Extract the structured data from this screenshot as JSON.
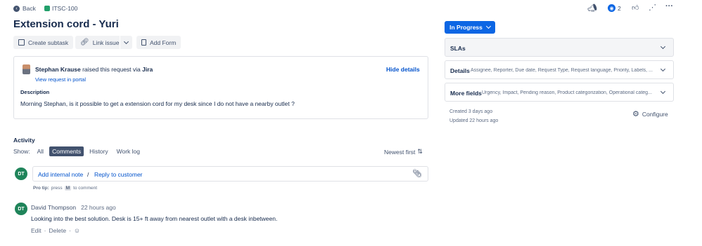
{
  "nav": {
    "back_label": "Back",
    "issue_key": "ITSC-100"
  },
  "header": {
    "title": "Extension cord - Yuri",
    "watch_count": "2"
  },
  "toolbar": {
    "create_subtask": "Create subtask",
    "link_issue": "Link issue",
    "add_form": "Add Form"
  },
  "request": {
    "reporter_name": "Stephan Krause",
    "raised_text": "raised this request via",
    "channel": "Jira",
    "view_portal": "View request in portal",
    "hide_details": "Hide details",
    "description_label": "Description",
    "description": "Morning Stephan, is it possible to get a extension cord for my desk since I do not have a nearby outlet ?"
  },
  "activity": {
    "heading": "Activity",
    "show_label": "Show:",
    "tabs": [
      "All",
      "Comments",
      "History",
      "Work log"
    ],
    "active_tab": "Comments",
    "sort_label": "Newest first",
    "current_user_initials": "DT",
    "add_internal_note": "Add internal note",
    "separator": "/",
    "reply_to_customer": "Reply to customer",
    "pro_tip_label": "Pro tip:",
    "pro_tip_press": "press",
    "pro_tip_key": "M",
    "pro_tip_rest": "to comment"
  },
  "comment": {
    "initials": "DT",
    "author": "David Thompson",
    "time": "22 hours ago",
    "body": "Looking into the best solution. Desk is 15+ ft away from nearest outlet with a desk inbetween.",
    "edit": "Edit",
    "dot": "·",
    "delete": "Delete"
  },
  "sidebar": {
    "status": "In Progress",
    "slas_label": "SLAs",
    "details_label": "Details",
    "details_fields": "Assignee, Reporter, Due date, Request Type, Request language, Priority, Labels, ...",
    "more_fields_label": "More fields",
    "more_fields": "Urgency, Impact, Pending reason, Product categorization, Operational categ...",
    "created": "Created 3 days ago",
    "updated": "Updated 22 hours ago",
    "configure": "Configure"
  },
  "colors": {
    "primary": "#0052cc",
    "avatar_green": "#1f845a",
    "issue_icon_green": "#22a06b",
    "status_blue": "#0c66e4"
  }
}
